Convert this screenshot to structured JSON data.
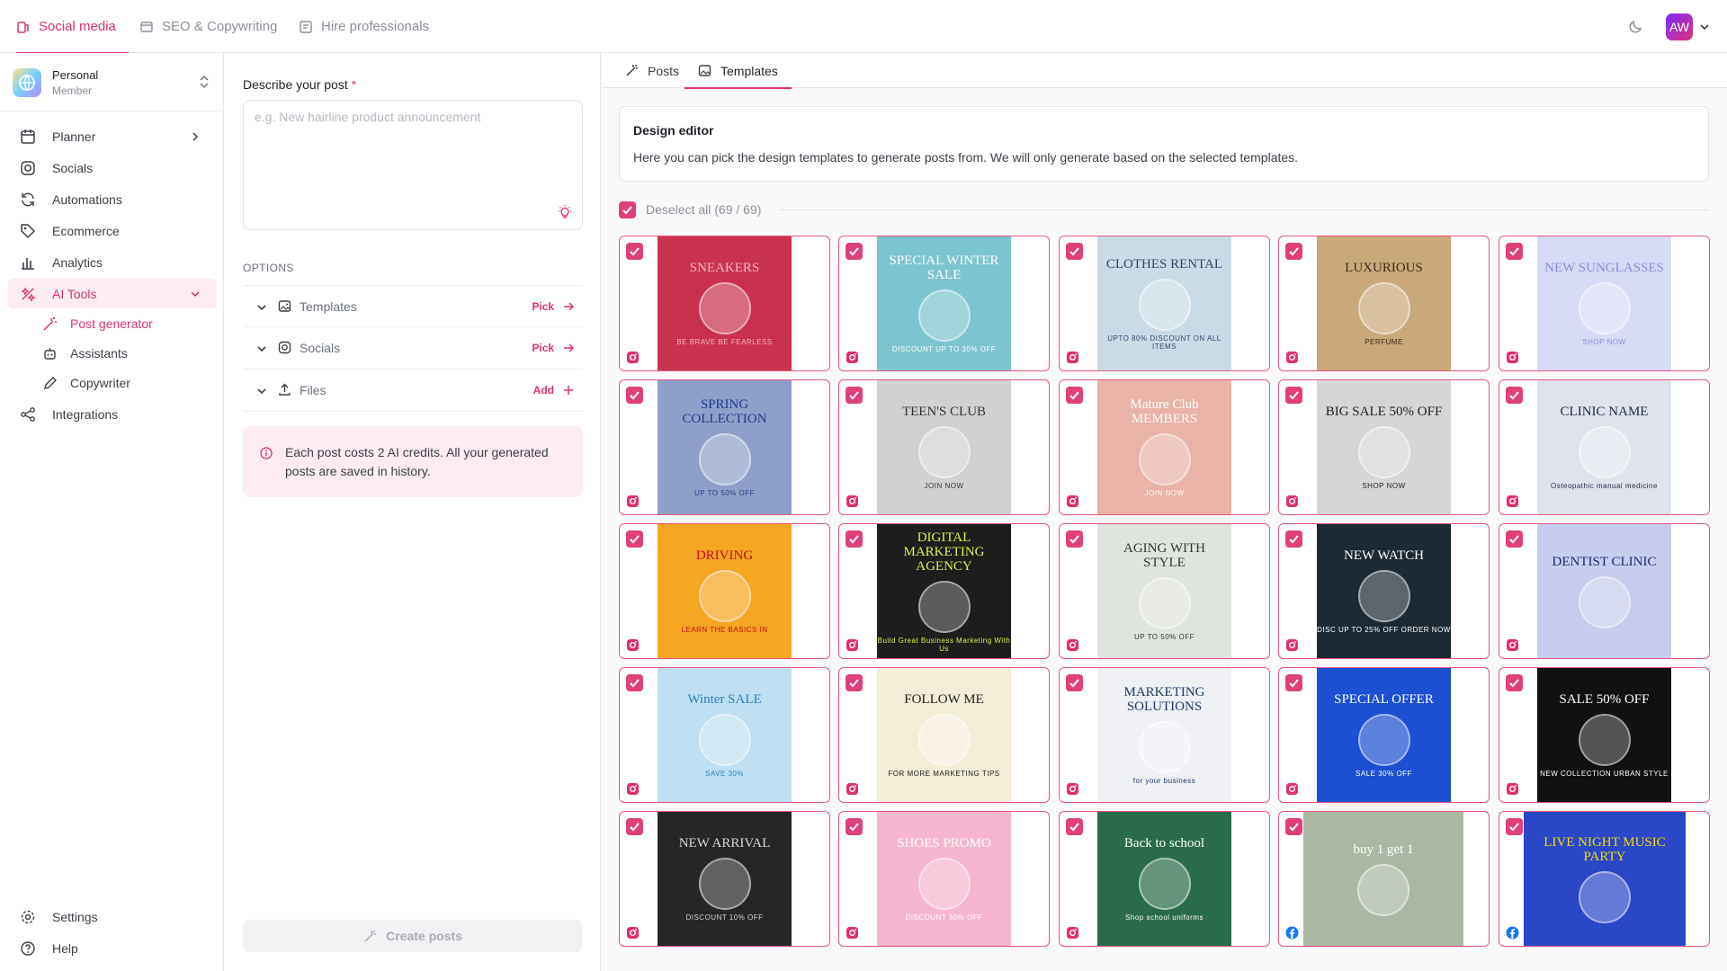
{
  "topnav": {
    "tabs": [
      {
        "label": "Social media",
        "icon": "social-icon",
        "active": true
      },
      {
        "label": "SEO & Copywriting",
        "icon": "document-icon",
        "active": false
      },
      {
        "label": "Hire professionals",
        "icon": "professionals-icon",
        "active": false
      }
    ],
    "avatar_initials": "AW"
  },
  "workspace": {
    "name": "Personal",
    "role": "Member"
  },
  "sidebar": {
    "items": [
      {
        "label": "Planner",
        "icon": "calendar-icon"
      },
      {
        "label": "Socials",
        "icon": "instagram-icon"
      },
      {
        "label": "Automations",
        "icon": "refresh-icon"
      },
      {
        "label": "Ecommerce",
        "icon": "tag-icon"
      },
      {
        "label": "Analytics",
        "icon": "bar-chart-icon"
      },
      {
        "label": "AI Tools",
        "icon": "ai-tools-icon",
        "active": true
      },
      {
        "label": "Integrations",
        "icon": "share-icon"
      }
    ],
    "subitems": [
      {
        "label": "Post generator",
        "icon": "magic-wand-icon",
        "active": true
      },
      {
        "label": "Assistants",
        "icon": "robot-icon"
      },
      {
        "label": "Copywriter",
        "icon": "pencil-icon"
      }
    ],
    "bottom": [
      {
        "label": "Settings",
        "icon": "gear-icon"
      },
      {
        "label": "Help",
        "icon": "help-icon"
      }
    ]
  },
  "form": {
    "label": "Describe your post",
    "required_mark": "*",
    "placeholder": "e.g. New hairline product announcement",
    "options_title": "OPTIONS",
    "options": [
      {
        "label": "Templates",
        "action": "Pick"
      },
      {
        "label": "Socials",
        "action": "Pick"
      },
      {
        "label": "Files",
        "action": "Add"
      }
    ],
    "info": "Each post costs 2 AI credits. All your generated posts are saved in history.",
    "create_label": "Create posts"
  },
  "main": {
    "tabs": [
      {
        "label": "Posts",
        "active": false
      },
      {
        "label": "Templates",
        "active": true
      }
    ],
    "design_editor": {
      "title": "Design editor",
      "description": "Here you can pick the design templates to generate posts from. We will only generate based on the selected templates."
    },
    "deselect_label": "Deselect all (69 / 69)",
    "accent": "#d9346b"
  },
  "templates": [
    {
      "title": "SNEAKERS",
      "sub": "BE BRAVE BE FEARLESS",
      "bg": "#c8324f",
      "fg": "#f3b6c2",
      "network": "instagram"
    },
    {
      "title": "SPECIAL WINTER SALE",
      "sub": "DISCOUNT UP TO 30% OFF",
      "bg": "#7cc4cf",
      "fg": "#ffffff",
      "network": "instagram"
    },
    {
      "title": "CLOTHES RENTAL",
      "sub": "UPTO 80% DISCOUNT ON ALL ITEMS",
      "bg": "#c9dbe6",
      "fg": "#2d4a6d",
      "network": "instagram"
    },
    {
      "title": "LUXURIOUS",
      "sub": "PERFUME",
      "bg": "#c9a87a",
      "fg": "#3b2a16",
      "network": "instagram"
    },
    {
      "title": "NEW SUNGLASSES",
      "sub": "SHOP NOW",
      "bg": "#d8dbf6",
      "fg": "#8b8fd9",
      "network": "instagram"
    },
    {
      "title": "SPRING COLLECTION",
      "sub": "UP TO 50% OFF",
      "bg": "#8ea0c9",
      "fg": "#1f3a8a",
      "network": "instagram"
    },
    {
      "title": "TEEN'S CLUB",
      "sub": "JOIN NOW",
      "bg": "#cfd1d3",
      "fg": "#333333",
      "network": "instagram"
    },
    {
      "title": "Mature Club MEMBERS",
      "sub": "JOIN NOW",
      "bg": "#e9b3a8",
      "fg": "#ffffff",
      "network": "instagram"
    },
    {
      "title": "BIG SALE 50% OFF",
      "sub": "SHOP NOW",
      "bg": "#d6d6d6",
      "fg": "#222222",
      "network": "instagram"
    },
    {
      "title": "CLINIC NAME",
      "sub": "Osteopathic manual medicine",
      "bg": "#dfe3ec",
      "fg": "#1f2a44",
      "network": "instagram"
    },
    {
      "title": "DRIVING",
      "sub": "LEARN THE BASICS IN",
      "bg": "#f5a623",
      "fg": "#c0101a",
      "network": "instagram"
    },
    {
      "title": "DIGITAL MARKETING AGENCY",
      "sub": "Build Great Business Marketing With Us",
      "bg": "#1d1d1d",
      "fg": "#d7f24b",
      "network": "instagram"
    },
    {
      "title": "AGING WITH STYLE",
      "sub": "UP TO 50% OFF",
      "bg": "#dfe4dc",
      "fg": "#2f3a2f",
      "network": "instagram"
    },
    {
      "title": "NEW WATCH",
      "sub": "DISC UP TO 25% OFF ORDER NOW",
      "bg": "#1b2a35",
      "fg": "#ffffff",
      "network": "instagram"
    },
    {
      "title": "DENTIST CLINIC",
      "sub": "",
      "bg": "#c6cdee",
      "fg": "#1f2a6b",
      "network": "instagram"
    },
    {
      "title": "Winter SALE",
      "sub": "SAVE 30%",
      "bg": "#bfe0f2",
      "fg": "#2e7fc2",
      "network": "instagram"
    },
    {
      "title": "FOLLOW ME",
      "sub": "FOR MORE MARKETING TIPS",
      "bg": "#f3ecd7",
      "fg": "#222222",
      "network": "instagram"
    },
    {
      "title": "MARKETING SOLUTIONS",
      "sub": "for your business",
      "bg": "#eef0f4",
      "fg": "#1d3b66",
      "network": "instagram"
    },
    {
      "title": "SPECIAL OFFER",
      "sub": "SALE 30% OFF",
      "bg": "#1c4fd1",
      "fg": "#ffffff",
      "network": "instagram"
    },
    {
      "title": "SALE 50% OFF",
      "sub": "NEW COLLECTION URBAN STYLE",
      "bg": "#111111",
      "fg": "#ffffff",
      "network": "instagram"
    },
    {
      "title": "NEW ARRIVAL",
      "sub": "DISCOUNT 10% OFF",
      "bg": "#262626",
      "fg": "#d6d6d6",
      "network": "instagram"
    },
    {
      "title": "SHOES PROMO",
      "sub": "DISCOUNT 30% OFF",
      "bg": "#f6b6cf",
      "fg": "#ffffff",
      "network": "instagram"
    },
    {
      "title": "Back to school",
      "sub": "Shop school uniforms",
      "bg": "#2a6b4a",
      "fg": "#ffffff",
      "network": "instagram"
    },
    {
      "title": "buy 1 get 1",
      "sub": "",
      "bg": "#a9b8a3",
      "fg": "#ffffff",
      "network": "facebook"
    },
    {
      "title": "LIVE NIGHT MUSIC PARTY",
      "sub": "",
      "bg": "#2a47c8",
      "fg": "#f5d90a",
      "network": "facebook"
    }
  ]
}
